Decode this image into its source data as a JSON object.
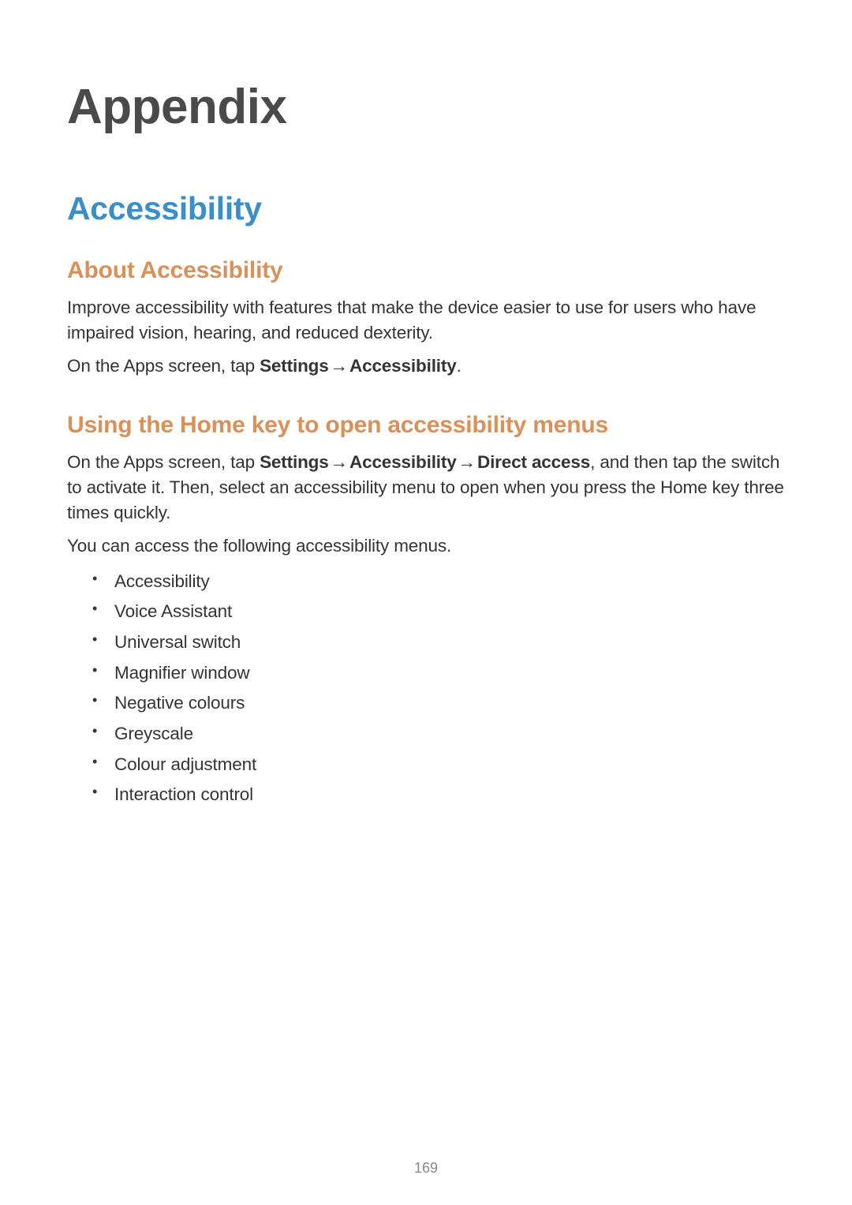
{
  "title": "Appendix",
  "section": "Accessibility",
  "sub1": {
    "heading": "About Accessibility",
    "p1": "Improve accessibility with features that make the device easier to use for users who have impaired vision, hearing, and reduced dexterity.",
    "p2_prefix": "On the Apps screen, tap ",
    "p2_settings": "Settings",
    "p2_arrow": " → ",
    "p2_access": "Accessibility",
    "p2_suffix": "."
  },
  "sub2": {
    "heading": "Using the Home key to open accessibility menus",
    "p1_prefix": "On the Apps screen, tap ",
    "p1_settings": "Settings",
    "p1_arrow1": " → ",
    "p1_access": "Accessibility",
    "p1_arrow2": " → ",
    "p1_direct": "Direct access",
    "p1_suffix": ", and then tap the switch to activate it. Then, select an accessibility menu to open when you press the Home key three times quickly.",
    "p2": "You can access the following accessibility menus.",
    "items": [
      "Accessibility",
      "Voice Assistant",
      "Universal switch",
      "Magnifier window",
      "Negative colours",
      "Greyscale",
      "Colour adjustment",
      "Interaction control"
    ]
  },
  "page_number": "169"
}
